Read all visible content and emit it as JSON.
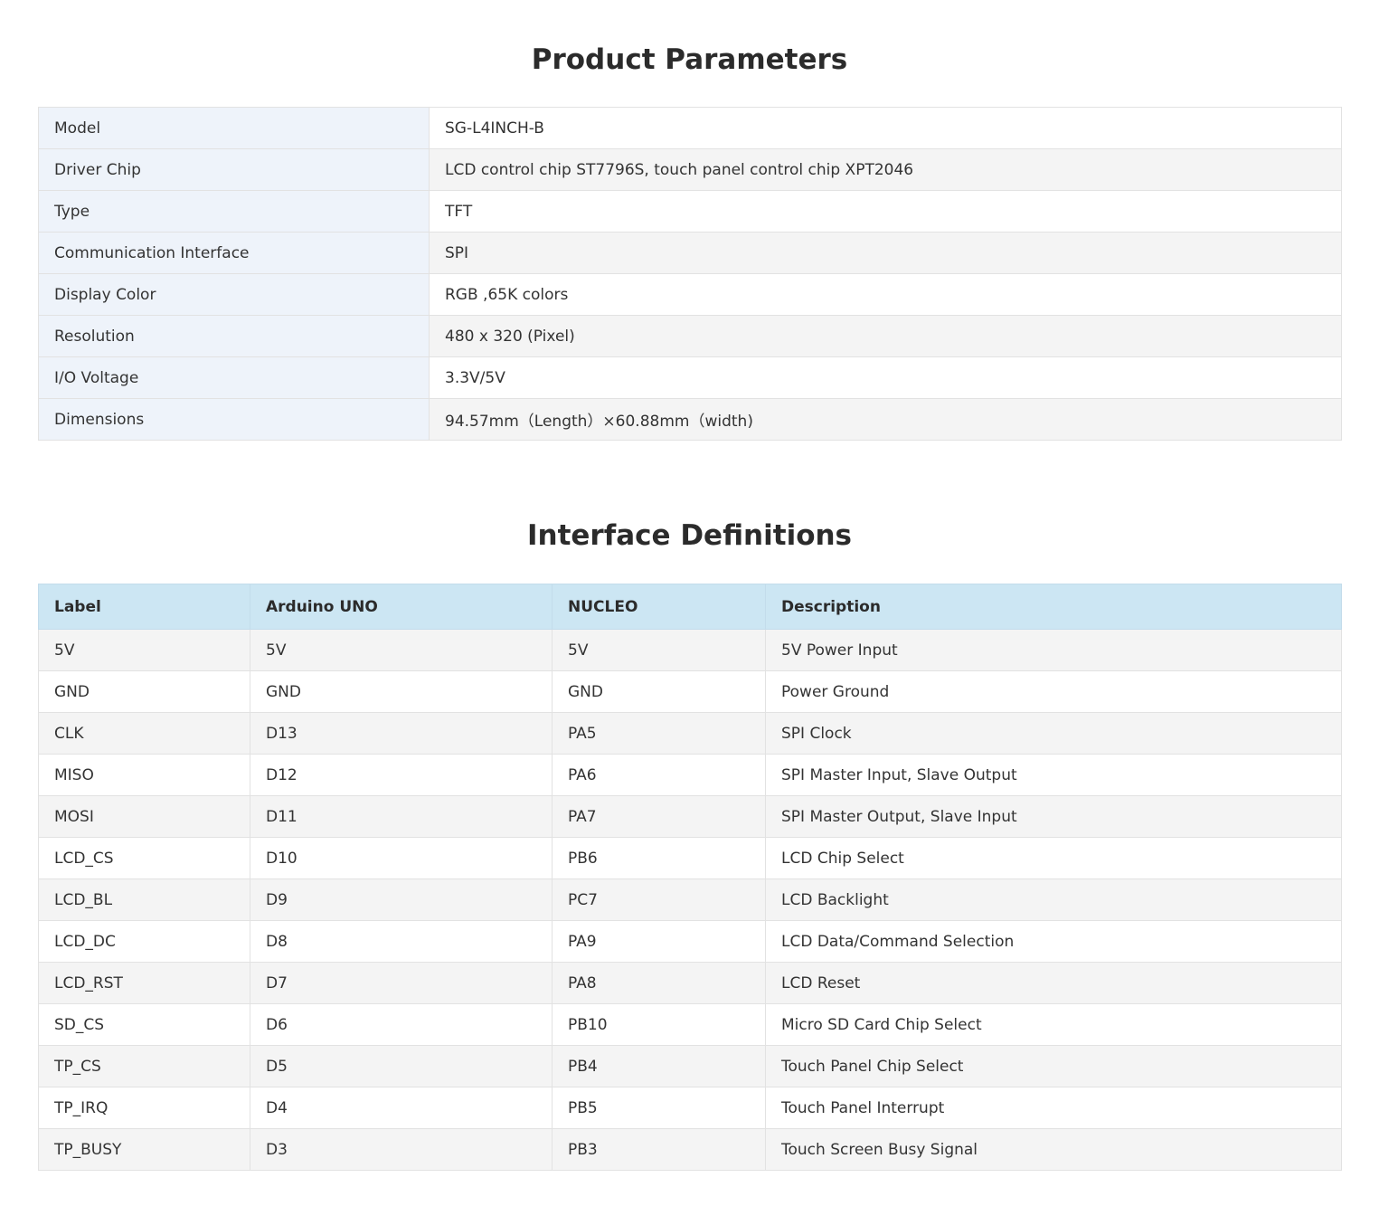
{
  "product_parameters": {
    "title": "Product Parameters",
    "rows": [
      {
        "key": "Model",
        "value": "SG-L4INCH-B"
      },
      {
        "key": "Driver Chip",
        "value": "LCD control chip ST7796S, touch panel control chip XPT2046"
      },
      {
        "key": "Type",
        "value": "TFT"
      },
      {
        "key": "Communication Interface",
        "value": "SPI"
      },
      {
        "key": "Display Color",
        "value": "RGB ,65K colors"
      },
      {
        "key": "Resolution",
        "value": "480 x 320 (Pixel)"
      },
      {
        "key": "I/O Voltage",
        "value": "3.3V/5V"
      },
      {
        "key": "Dimensions",
        "value": "94.57mm（Length）×60.88mm（width)"
      }
    ]
  },
  "interface_definitions": {
    "title": "Interface Definitions",
    "headers": [
      "Label",
      "Arduino UNO",
      "NUCLEO",
      "Description"
    ],
    "rows": [
      [
        "5V",
        "5V",
        "5V",
        "5V Power Input"
      ],
      [
        "GND",
        "GND",
        "GND",
        "Power Ground"
      ],
      [
        "CLK",
        "D13",
        "PA5",
        "SPI Clock"
      ],
      [
        "MISO",
        "D12",
        "PA6",
        "SPI Master Input, Slave Output"
      ],
      [
        "MOSI",
        "D11",
        "PA7",
        "SPI Master Output, Slave Input"
      ],
      [
        "LCD_CS",
        "D10",
        "PB6",
        "LCD Chip Select"
      ],
      [
        "LCD_BL",
        "D9",
        "PC7",
        "LCD Backlight"
      ],
      [
        "LCD_DC",
        "D8",
        "PA9",
        "LCD Data/Command Selection"
      ],
      [
        "LCD_RST",
        "D7",
        "PA8",
        "LCD Reset"
      ],
      [
        "SD_CS",
        "D6",
        "PB10",
        "Micro SD Card Chip Select"
      ],
      [
        "TP_CS",
        "D5",
        "PB4",
        "Touch Panel Chip Select"
      ],
      [
        "TP_IRQ",
        "D4",
        "PB5",
        "Touch Panel Interrupt"
      ],
      [
        "TP_BUSY",
        "D3",
        "PB3",
        "Touch Screen Busy Signal"
      ]
    ]
  },
  "colors": {
    "key_cell_bg": "#eef3fa",
    "header_bg": "#cce6f3",
    "stripe_bg": "#f4f4f4",
    "border": "#e2e2e2",
    "text": "#333333"
  }
}
